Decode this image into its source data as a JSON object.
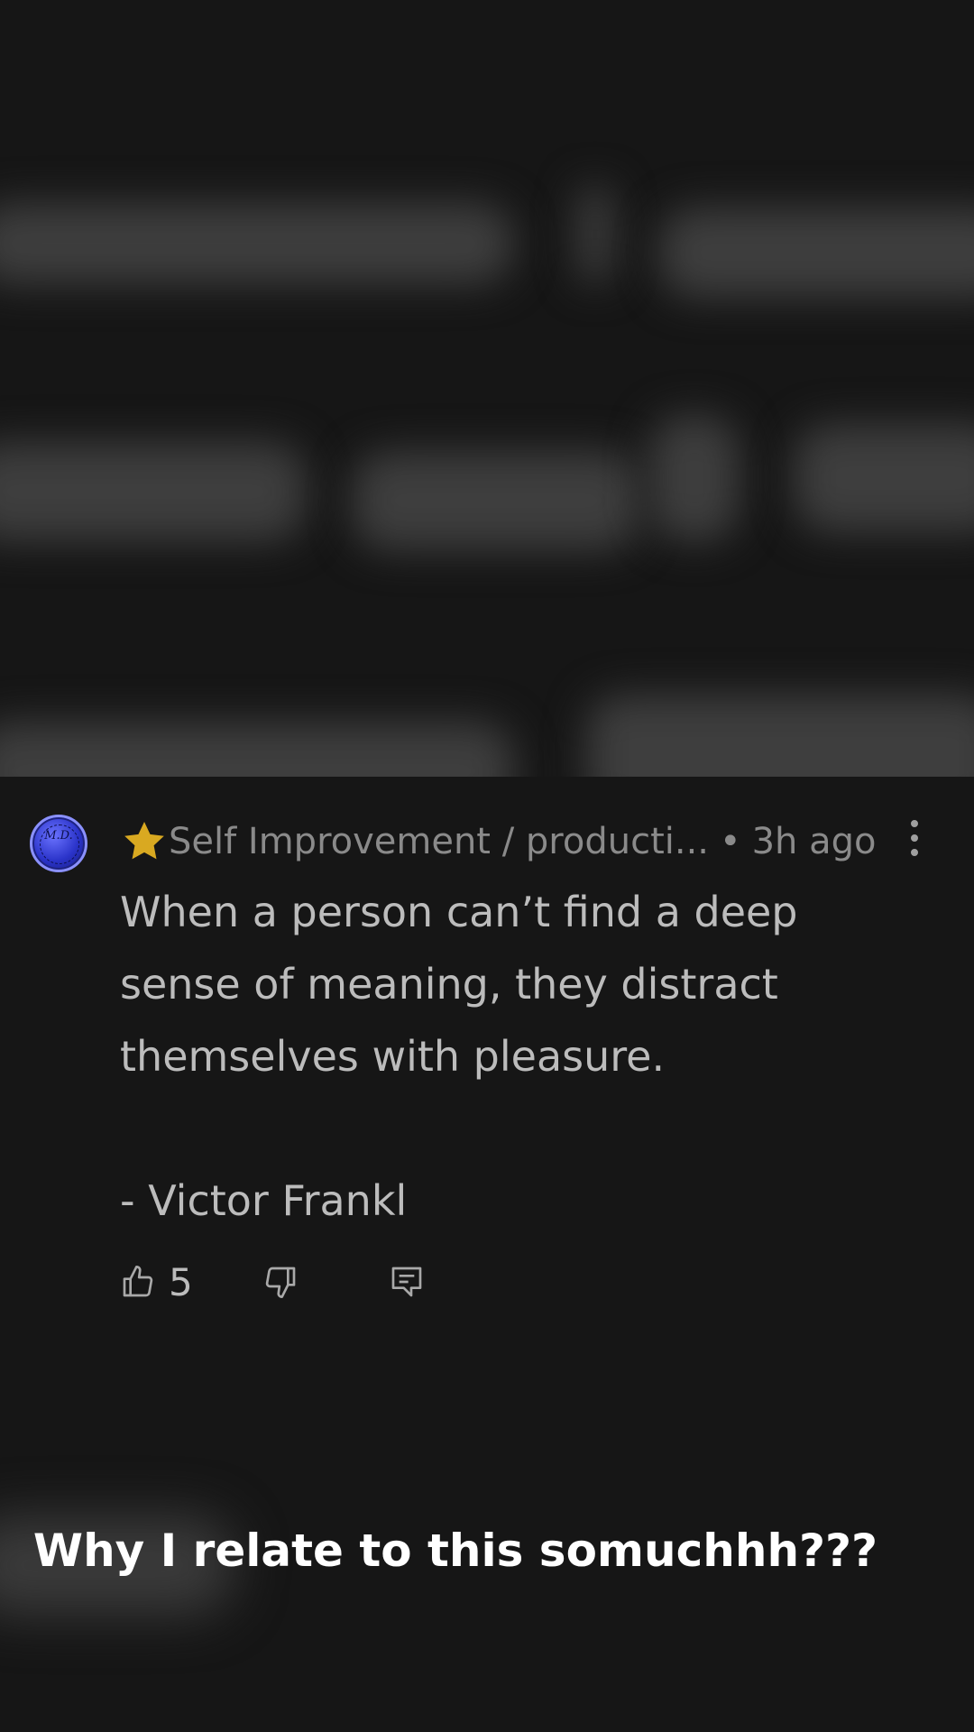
{
  "post": {
    "community": "Self Improvement / producti...",
    "separator": "•",
    "time": "3h ago",
    "avatar_text": "M.D.",
    "body": {
      "line1": "When a person can’t find a deep sense of meaning, they distract themselves with pleasure.",
      "attribution": "- Victor Frankl"
    },
    "likes": "5"
  },
  "caption": "Why I relate to this somuchhh???",
  "colors": {
    "background": "#161616",
    "star": "#d9a921",
    "avatar": "#2a33c9"
  },
  "icons": [
    "star-icon",
    "more-vertical-icon",
    "thumbs-up-icon",
    "thumbs-down-icon",
    "comment-icon"
  ]
}
